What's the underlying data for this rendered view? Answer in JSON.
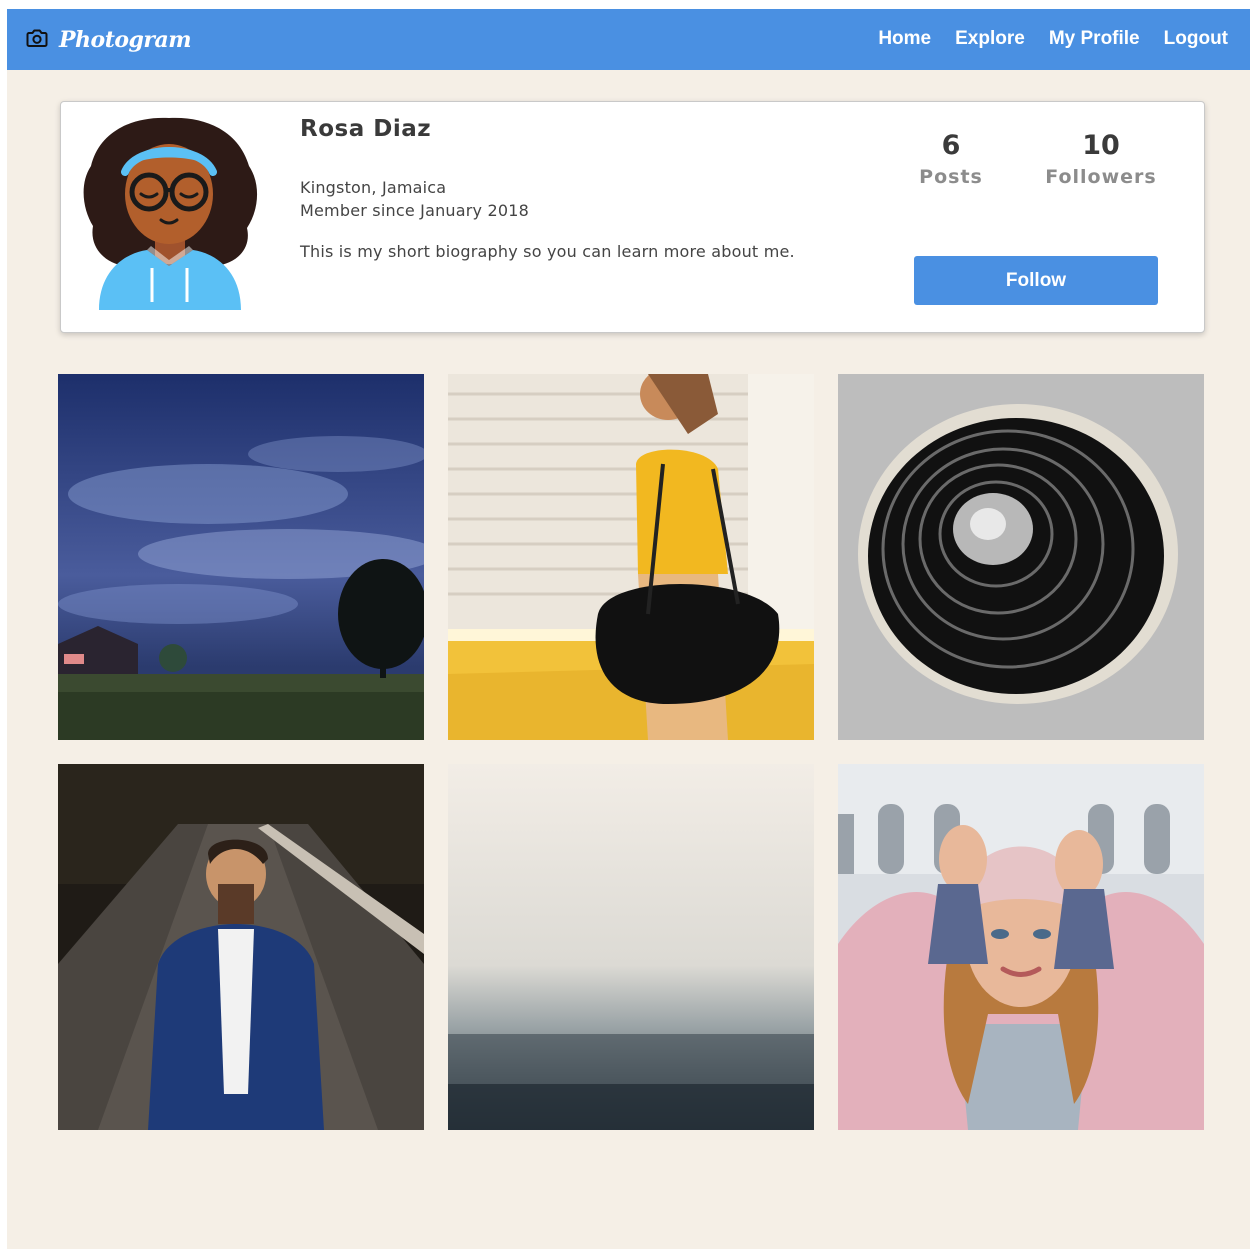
{
  "app": {
    "name": "Photogram",
    "logo_icon": "camera-icon"
  },
  "nav": {
    "items": [
      {
        "label": "Home"
      },
      {
        "label": "Explore"
      },
      {
        "label": "My Profile"
      },
      {
        "label": "Logout"
      }
    ]
  },
  "profile": {
    "name": "Rosa Diaz",
    "location": "Kingston, Jamaica",
    "member_since": "Member since January 2018",
    "bio": "This is my short biography so you can learn more about me.",
    "posts_count": "6",
    "posts_label": "Posts",
    "followers_count": "10",
    "followers_label": "Followers",
    "follow_label": "Follow"
  },
  "colors": {
    "primary": "#4a90e2",
    "page_background": "#f5efe6",
    "card_background": "#ffffff"
  },
  "photos": [
    {
      "subject": "night sky over house and trees"
    },
    {
      "subject": "woman with black handbag by yellow wall"
    },
    {
      "subject": "black paint swirl on concrete"
    },
    {
      "subject": "man in blue blazer on road"
    },
    {
      "subject": "foggy forest"
    },
    {
      "subject": "woman in pink beanie and coat"
    }
  ]
}
